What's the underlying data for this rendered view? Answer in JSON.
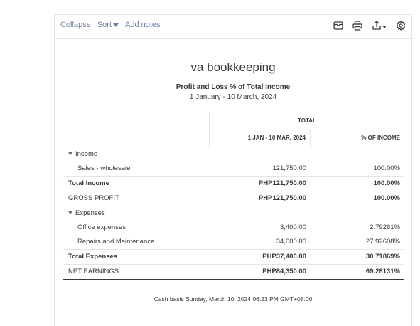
{
  "toolbar": {
    "collapse_label": "Collapse",
    "sort_label": "Sort",
    "add_notes_label": "Add notes",
    "icons": [
      "email-icon",
      "print-icon",
      "export-icon",
      "settings-icon"
    ]
  },
  "report": {
    "company": "va bookkeeping",
    "title": "Profit and Loss % of Total Income",
    "date_range": "1 January - 10 March, 2024",
    "header_group": "TOTAL",
    "col1_header": "1 JAN - 10 MAR, 2024",
    "col2_header": "% OF INCOME"
  },
  "rows": [
    {
      "label": "Income",
      "v1": "",
      "v2": "",
      "type": "section",
      "indent": 1,
      "line": false
    },
    {
      "label": "Sales - wholesale",
      "v1": "121,750.00",
      "v2": "100.00%",
      "type": "item",
      "indent": 2,
      "line": true
    },
    {
      "label": "Total Income",
      "v1": "PHP121,750.00",
      "v2": "100.00%",
      "type": "total",
      "indent": 1,
      "line": true
    },
    {
      "label": "GROSS PROFIT",
      "v1": "PHP121,750.00",
      "v2": "100.00%",
      "type": "total-upper",
      "indent": 1,
      "line": true
    },
    {
      "label": "Expenses",
      "v1": "",
      "v2": "",
      "type": "section",
      "indent": 1,
      "line": false
    },
    {
      "label": "Office expenses",
      "v1": "3,400.00",
      "v2": "2.79261%",
      "type": "item",
      "indent": 2,
      "line": false
    },
    {
      "label": "Repairs and Maintenance",
      "v1": "34,000.00",
      "v2": "27.92608%",
      "type": "item",
      "indent": 2,
      "line": true
    },
    {
      "label": "Total Expenses",
      "v1": "PHP37,400.00",
      "v2": "30.71869%",
      "type": "total",
      "indent": 1,
      "line": true
    },
    {
      "label": "NET EARNINGS",
      "v1": "PHP84,350.00",
      "v2": "69.28131%",
      "type": "total-upper",
      "indent": 1,
      "line": true
    }
  ],
  "footer": "Cash basis  Sunday, March 10, 2024  06:23 PM GMT+08:00"
}
